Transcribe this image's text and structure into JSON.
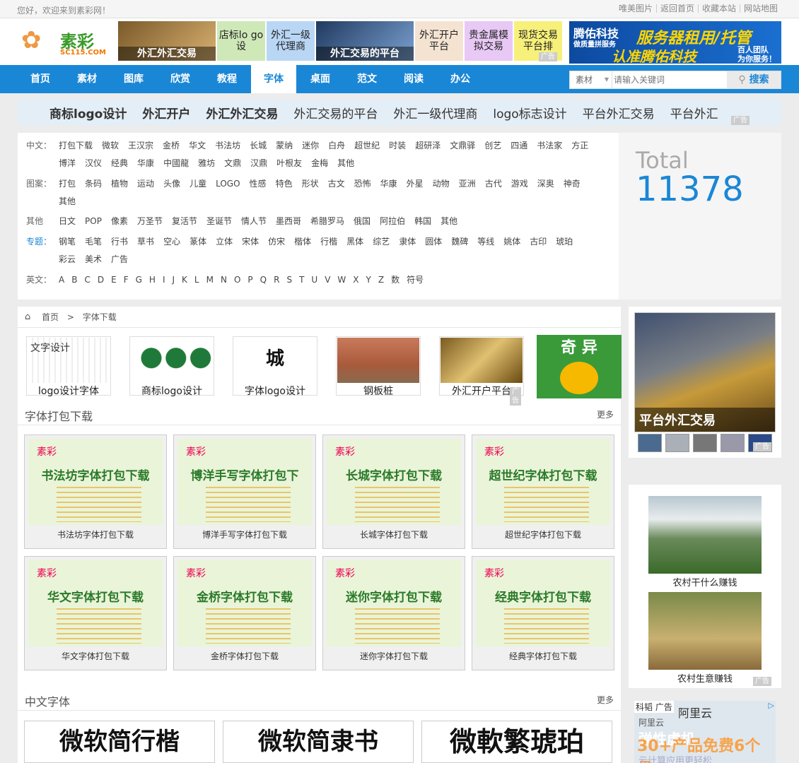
{
  "topbar": {
    "welcome": "您好，欢迎来到素彩网！",
    "links": [
      "唯美图片",
      "返回首页",
      "收藏本站",
      "网站地图"
    ]
  },
  "header": {
    "logo_text": "素彩",
    "logo_sub": "SC115.COM",
    "ads": [
      {
        "text": "外汇外汇交易"
      },
      {
        "text": "店标lo go设"
      },
      {
        "text": "外汇一级 代理商"
      },
      {
        "text": "外汇交易的平台"
      },
      {
        "text": "外汇开户 平台"
      },
      {
        "text": "贵金属模 拟交易"
      },
      {
        "text": "现货交易 平台排"
      }
    ],
    "ad_tag": "广告",
    "big_ad": {
      "l1": "腾佑科技",
      "l2": "做质量拼服务",
      "r1": "服务器租用/托管",
      "r2": "认准腾佑科技",
      "r3a": "百人团队",
      "r3b": "为你服务！"
    }
  },
  "nav": {
    "items": [
      "首页",
      "素材",
      "图库",
      "欣赏",
      "教程",
      "字体",
      "桌面",
      "范文",
      "阅读",
      "办公"
    ],
    "active_index": 5
  },
  "search": {
    "category": "素材",
    "placeholder": "请输入关键词",
    "button": "搜索"
  },
  "keywords": [
    {
      "text": "商标logo设计",
      "bold": true
    },
    {
      "text": "外汇开户",
      "bold": true
    },
    {
      "text": "外汇外汇交易",
      "bold": true
    },
    {
      "text": "外汇交易的平台",
      "bold": false
    },
    {
      "text": "外汇一级代理商",
      "bold": false
    },
    {
      "text": "logo标志设计",
      "bold": false
    },
    {
      "text": "平台外汇交易",
      "bold": false
    },
    {
      "text": "平台外汇",
      "bold": false
    }
  ],
  "filters": [
    {
      "label": "中文：",
      "values": [
        "打包下载",
        "微软",
        "王汉宗",
        "金桥",
        "华文",
        "书法坊",
        "长城",
        "蒙纳",
        "迷你",
        "白舟",
        "超世纪",
        "时装",
        "超研泽",
        "文鼎驿",
        "创艺",
        "四通",
        "书法家",
        "方正",
        "博洋",
        "汉仪",
        "经典",
        "华康",
        "中國龍",
        "雅坊",
        "文鼎",
        "汉鼎",
        "叶根友",
        "金梅",
        "其他"
      ]
    },
    {
      "label": "图案：",
      "values": [
        "打包",
        "条码",
        "植物",
        "运动",
        "头像",
        "儿童",
        "LOGO",
        "性感",
        "特色",
        "形状",
        "古文",
        "恐怖",
        "华康",
        "外星",
        "动物",
        "亚洲",
        "古代",
        "游戏",
        "深奥",
        "神奇",
        "其他"
      ]
    },
    {
      "label": "其他",
      "values": [
        "日文",
        "POP",
        "像素",
        "万圣节",
        "复活节",
        "圣诞节",
        "情人节",
        "墨西哥",
        "希腊罗马",
        "俄国",
        "阿拉伯",
        "韩国",
        "其他"
      ]
    },
    {
      "label": "专题：",
      "values": [
        "钢笔",
        "毛笔",
        "行书",
        "草书",
        "空心",
        "篆体",
        "立体",
        "宋体",
        "仿宋",
        "楷体",
        "行楷",
        "黑体",
        "综艺",
        "隶体",
        "圆体",
        "魏碑",
        "等线",
        "姚体",
        "古印",
        "琥珀",
        "彩云",
        "美术",
        "广告"
      ]
    },
    {
      "label": "英文：",
      "values": [
        "A",
        "B",
        "C",
        "D",
        "E",
        "F",
        "G",
        "H",
        "I",
        "J",
        "K",
        "L",
        "M",
        "N",
        "O",
        "P",
        "Q",
        "R",
        "S",
        "T",
        "U",
        "V",
        "W",
        "X",
        "Y",
        "Z",
        "数",
        "符号"
      ]
    }
  ],
  "total": {
    "label": "Total",
    "count": "11378"
  },
  "breadcrumb": {
    "home": "首页",
    "sep": ">",
    "current": "字体下载"
  },
  "thumbs": [
    "logo设计字体",
    "商标logo设计",
    "字体logo设计",
    "钢板桩",
    "外汇开户平台"
  ],
  "odd_ad": "奇 异",
  "section1": {
    "title": "字体打包下载",
    "more": "更多"
  },
  "cards": [
    {
      "img_title": "书法坊字体打包下载",
      "caption": "书法坊字体打包下载"
    },
    {
      "img_title": "博洋手写字体打包下",
      "caption": "博洋手写字体打包下载"
    },
    {
      "img_title": "长城字体打包下载",
      "caption": "长城字体打包下载"
    },
    {
      "img_title": "超世纪字体打包下载",
      "caption": "超世纪字体打包下载"
    },
    {
      "img_title": "华文字体打包下载",
      "caption": "华文字体打包下载"
    },
    {
      "img_title": "金桥字体打包下载",
      "caption": "金桥字体打包下载"
    },
    {
      "img_title": "迷你字体打包下载",
      "caption": "迷你字体打包下载"
    },
    {
      "img_title": "经典字体打包下载",
      "caption": "经典字体打包下载"
    }
  ],
  "card_logo": "素彩",
  "section2": {
    "title": "中文字体",
    "more": "更多"
  },
  "fonts": [
    "微软简行楷",
    "微软简隶书",
    "微軟繁琥珀"
  ],
  "sidebar": {
    "big_caption": "平台外汇交易",
    "img1_caption": "农村干什么赚钱",
    "img2_caption": "农村生意赚钱",
    "ali": {
      "tag": "科韬 广告",
      "brand": "阿里云",
      "brand2": "阿里云",
      "line1": "弹性虚机",
      "line2": "30+产品免费6个月",
      "line3": "云计算应用更轻松"
    }
  }
}
